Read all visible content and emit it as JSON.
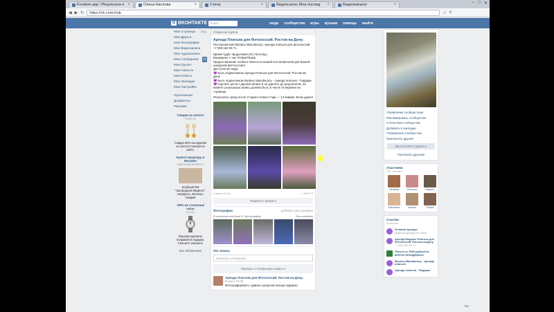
{
  "browser": {
    "tabs": [
      {
        "label": "Kundom.app / Результати п",
        "active": false
      },
      {
        "label": "Олена Кислова",
        "active": true
      },
      {
        "label": "Стена",
        "active": false
      },
      {
        "label": "Видеосалон Мои послед",
        "active": false
      },
      {
        "label": "Видеокаталог",
        "active": false
      }
    ],
    "url": "https://vk.com/club",
    "controls": [
      "–",
      "□",
      "✕"
    ]
  },
  "vk": {
    "logo": "ВКОНТАКТЕ",
    "logo_badge": "В",
    "search_placeholder": "Поиск",
    "nav": [
      "люди",
      "сообщества",
      "игры",
      "музыка",
      "помощь",
      "выйти"
    ]
  },
  "left_nav": {
    "items": [
      {
        "label": "Моя Страница",
        "count": "ред."
      },
      {
        "label": "Мои Друзья",
        "count": ""
      },
      {
        "label": "Мои Фотографии",
        "count": ""
      },
      {
        "label": "Мои Видеозаписи",
        "count": ""
      },
      {
        "label": "Мои Аудиозаписи",
        "count": ""
      },
      {
        "label": "Мои Сообщения",
        "count": "+1"
      },
      {
        "label": "Мои Группы",
        "count": ""
      },
      {
        "label": "Мои Новости",
        "count": ""
      },
      {
        "label": "Мои Ответы",
        "count": ""
      },
      {
        "label": "Мои Закладки",
        "count": ""
      },
      {
        "label": "Мои Настройки",
        "count": ""
      }
    ],
    "extra": [
      "Приложения",
      "Документы",
      "Реклама"
    ]
  },
  "ads": [
    {
      "title": "Скидки на золото",
      "url": "kuver.ru",
      "text": "Скидка 30% на изделия из золота! Смотри на сайте.",
      "color": "#d4a53a"
    },
    {
      "title": "Купите квартиру в Москве!",
      "url": "zagorodnyi-kvartal.ru",
      "text": "Клубный ЖК \"Загородный Квартал\". Недорого, Ипотека. Скидки!",
      "color": "#c9b7a2"
    },
    {
      "title": "-50% на стильные часы",
      "url": "vk.com",
      "text": "Вашему мужчине понравится подарок. Спешите заказать!",
      "color": "#9a9a9a"
    }
  ],
  "all_ads": "Все объявления",
  "group": {
    "header": "Открытая группа",
    "title": "Аренда Платьев для Фотосессий. Ростов-на-Дону.",
    "desc": [
      "Постановочная Mystery Manufactory. Аренда платьев для фотосессий +7 909 184 95 71.",
      "",
      "Время чудес продолжается!:) Поэтому...",
      "Внимание! У нас РОЗЫГРЫШ!",
      "Предоставление особого платья из нашей постановочной для Вашей шикарной фотосессии!",
      "Для участия надо:",
      "💜 Быть подписчиком Аренда Платьев для Фотосессий. Ростов-на-Дону",
      "💜 Быть подписчиком Mystery Manufactory - Аренда платьев - Подарки",
      "💜 Сделать репост данной записи и не удалять до результатов, на момент розыгрыша запись должна быть в числе 3х верхних на странице.",
      "",
      "Результаты сразу после Старого Нового Года — 14 января. Всем удачи!"
    ],
    "meta_left": "9 янв в 19:45",
    "meta_likes": "46",
    "meta_reposts": "70",
    "to_wall": "Перейти к записи ▾",
    "photos_title": "Фотографии",
    "photos_link": "добавить фотографии",
    "photos_sub_left": "В основном альбоме 67 фотографий",
    "photos_sub_right": "Все альбомы",
    "wall_title": "261 запись",
    "wall_input": "Написать сообщение...",
    "wall_tabs": "Показать 1 отложенную запись ▾",
    "post_title": "Аренда Платьев для Фотосессий. Ростов-на-Дону.",
    "post_sub": "вчера в 15:35",
    "post_text": "Фотографировать «дивою» досрочно всегда подарок)"
  },
  "right": {
    "menu": [
      "Управление сообществом",
      "Рекламировать сообщество",
      "Статистика сообщества",
      "Добавить в закладки",
      "Упоминания сообщества",
      "Пригласить друзей"
    ],
    "in_group": "Вы состоите в группе ▾",
    "tell_friends": "Рассказать друзьям",
    "members_title": "Участники",
    "members_count": "781 человек",
    "members": [
      {
        "name": "Татьяна",
        "color": "#a36a4a"
      },
      {
        "name": "Юлечка",
        "color": "#c98a8a"
      },
      {
        "name": "Кирилл",
        "color": "#6a5a4a"
      },
      {
        "name": "Светлана",
        "color": "#d8b394"
      },
      {
        "name": "Ирина",
        "color": "#b09072"
      },
      {
        "name": "Юлия",
        "color": "#826350"
      }
    ],
    "links_title": "Ссылки",
    "links_count": "5 ссылок",
    "links": [
      {
        "title": "Условия Аренды",
        "sub": "правила аренды на сайте",
        "color": "#9b5fd1"
      },
      {
        "title": "Аренда Модных Платьев для Фотосессий. Ростов-на-Дону.",
        "sub": "+7 909 184 95 71",
        "color": "#9b5fd1"
      },
      {
        "title": "Платья от 3000 рублей на МОРОЗ ПРАЗДНИКАХ",
        "sub": "",
        "color": "#2f7d3a"
      },
      {
        "title": "Mystery Manufactory - Аренда платьев",
        "sub": "",
        "color": "#9b5fd1"
      },
      {
        "title": "Аренда платьев - Подарки",
        "sub": "",
        "color": "#9b5fd1"
      }
    ]
  },
  "chat_badge": "Чат"
}
